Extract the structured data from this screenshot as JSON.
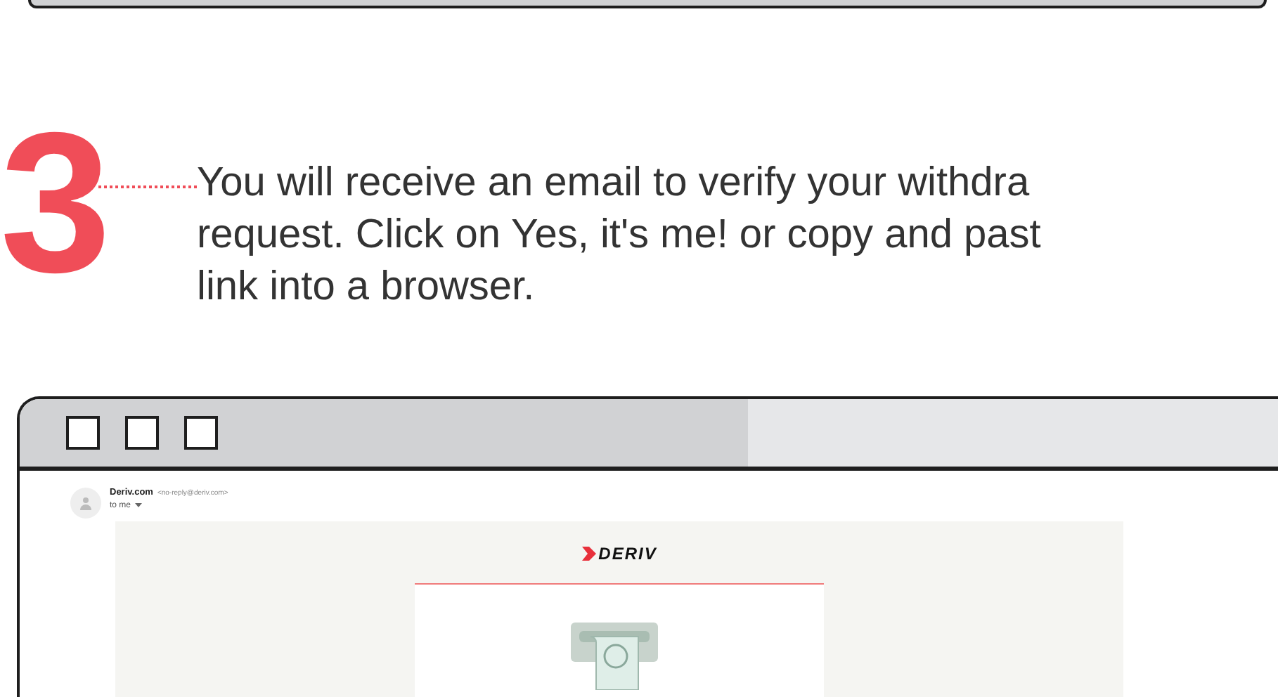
{
  "step": {
    "number": "3",
    "lines": [
      "You will receive an email to verify your withdra",
      "request. Click on Yes, it's me! or copy and past",
      "link into a browser."
    ]
  },
  "email": {
    "sender_name": "Deriv.com",
    "sender_address": "<no-reply@deriv.com>",
    "recipient": "to me",
    "logo_text": "DERIV"
  }
}
